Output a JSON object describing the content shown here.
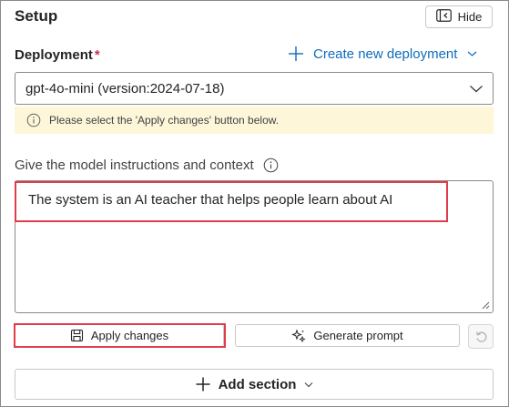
{
  "panel": {
    "title": "Setup"
  },
  "hide_button": {
    "label": "Hide",
    "icon": "panel-collapse-icon"
  },
  "deployment": {
    "label": "Deployment",
    "required_marker": "*",
    "create_link": "Create new deployment",
    "selected_value": "gpt-4o-mini (version:2024-07-18)",
    "notice": "Please select the 'Apply changes' button below."
  },
  "instructions": {
    "label": "Give the model instructions and context",
    "value": "The system is an AI teacher that helps people learn about AI"
  },
  "actions": {
    "apply_label": "Apply changes",
    "generate_label": "Generate prompt",
    "reset_icon": "undo-icon"
  },
  "add_section": {
    "label": "Add section"
  },
  "colors": {
    "accent": "#0f6cbd",
    "required": "#c4314b",
    "notice_bg": "#fdf6d9",
    "highlight": "#e03c4b"
  }
}
